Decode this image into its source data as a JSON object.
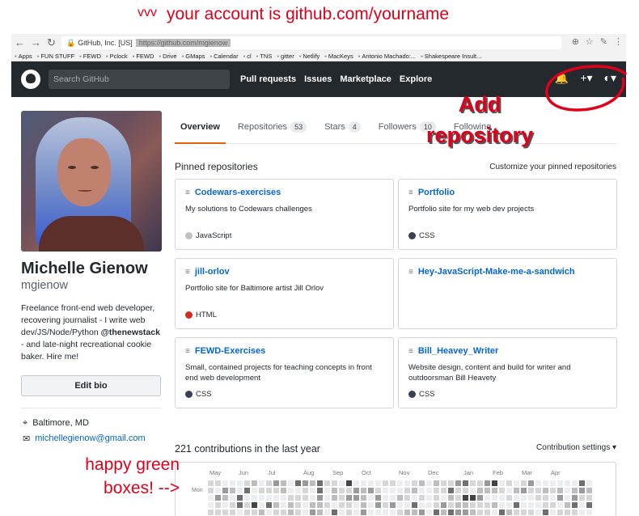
{
  "annotations": {
    "top_vvv": "vvv",
    "top_text": "your account is github.com/yourname",
    "add_repository": "Add repository",
    "happy_boxes_line1": "happy green",
    "happy_boxes_line2": "boxes! -->"
  },
  "browser": {
    "site_label": "GitHub, Inc. [US]",
    "url": "https://github.com/mgienow",
    "bookmarks": [
      "Apps",
      "FUN STUFF",
      "FEWD",
      "Pclock",
      "FEWD",
      "Drive",
      "GMaps",
      "Calendar",
      "cl",
      "TNS",
      "gitter",
      "Netlify",
      "MacKeys",
      "Antonio Machado:...",
      "Shakespeare Insult..."
    ]
  },
  "header": {
    "search_placeholder": "Search GitHub",
    "nav": [
      "Pull requests",
      "Issues",
      "Marketplace",
      "Explore"
    ]
  },
  "profile": {
    "full_name": "Michelle Gienow",
    "username": "mgienow",
    "bio_text": "Freelance front-end web developer, recovering journalist - I write web dev/JS/Node/Python",
    "bio_mention": "@thenewstack",
    "bio_tail": " - and late-night recreational cookie baker. Hire me!",
    "edit_bio_label": "Edit bio",
    "location": "Baltimore, MD",
    "email": "michellegienow@gmail.com"
  },
  "tabs": [
    {
      "label": "Overview",
      "count": ""
    },
    {
      "label": "Repositories",
      "count": "53"
    },
    {
      "label": "Stars",
      "count": "4"
    },
    {
      "label": "Followers",
      "count": "10"
    },
    {
      "label": "Following",
      "count": ""
    }
  ],
  "pinned": {
    "heading": "Pinned repositories",
    "customize": "Customize your pinned repositories",
    "repos": [
      {
        "name": "Codewars-exercises",
        "desc": "My solutions to Codewars challenges",
        "lang": "JavaScript",
        "lang_color": "#c0c0c0"
      },
      {
        "name": "Portfolio",
        "desc": "Portfolio site for my web dev projects",
        "lang": "CSS",
        "lang_color": "#3a3f55"
      },
      {
        "name": "jill-orlov",
        "desc": "Portfolio site for Baltimore artist Jill Orlov",
        "lang": "HTML",
        "lang_color": "#d12a1e"
      },
      {
        "name": "Hey-JavaScript-Make-me-a-sandwich",
        "desc": "",
        "lang": "",
        "lang_color": ""
      },
      {
        "name": "FEWD-Exercises",
        "desc": "Small, contained projects for teaching concepts in front end web development",
        "lang": "CSS",
        "lang_color": "#3a3f55"
      },
      {
        "name": "Bill_Heavey_Writer",
        "desc": "Website design, content and build for writer and outdoorsman Bill Heavety",
        "lang": "CSS",
        "lang_color": "#3a3f55"
      }
    ]
  },
  "contributions": {
    "heading": "221 contributions in the last year",
    "settings": "Contribution settings ▾",
    "months": [
      "May",
      "Jun",
      "Jul",
      "Aug",
      "Sep",
      "Oct",
      "Nov",
      "Dec",
      "Jan",
      "Feb",
      "Mar",
      "Apr"
    ],
    "day_label": "Mon"
  }
}
